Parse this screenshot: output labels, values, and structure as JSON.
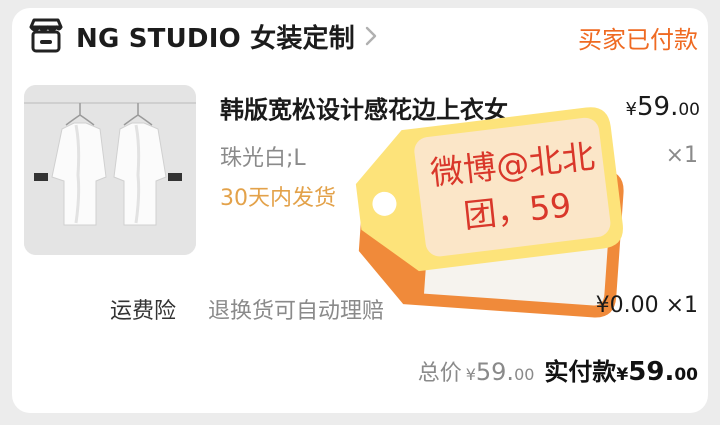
{
  "store": {
    "name": "NG STUDIO 女装定制",
    "status": "买家已付款",
    "icon": "store-icon"
  },
  "product": {
    "title": "韩版宽松设计感花边上衣女",
    "price_symbol": "¥",
    "price_int": "59.",
    "price_dec": "00",
    "spec": "珠光白;L",
    "quantity": "×1",
    "delivery": "30天内发货"
  },
  "overlay_tag": {
    "text": "微博@北北团，59",
    "line1": "微博@北北",
    "line2": "团，59",
    "colors": {
      "front": "#fde37a",
      "back": "#f08a3a",
      "text": "#d9372a"
    }
  },
  "insurance": {
    "label": "运费险",
    "description": "退换货可自动理赔",
    "price": "¥0.00 ×1"
  },
  "summary": {
    "total_label": "总价",
    "total_symbol": "¥",
    "total_int": "59.",
    "total_dec": "00",
    "paid_label": "实付款",
    "paid_symbol": "¥",
    "paid_int": "59.",
    "paid_dec": "00"
  },
  "colors": {
    "accent": "#ef6a22",
    "delivery": "#e3a24a",
    "muted": "#8a8a8a"
  }
}
